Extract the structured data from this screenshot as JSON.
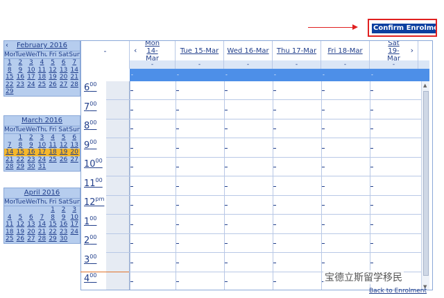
{
  "confirm_button": "Confirm Enrolme",
  "back_link": "Back to Enrolment",
  "watermark": "宝德立斯留学移民",
  "scheduler": {
    "corner": "-",
    "prev_nav": "‹",
    "next_nav": "›",
    "days": [
      "Mon 14-Mar",
      "Tue 15-Mar",
      "Wed 16-Mar",
      "Thu 17-Mar",
      "Fri 18-Mar",
      "Sat 19-Mar"
    ],
    "dash": "-",
    "hours": [
      {
        "h": "6",
        "s": "00"
      },
      {
        "h": "7",
        "s": "00"
      },
      {
        "h": "8",
        "s": "00"
      },
      {
        "h": "9",
        "s": "00"
      },
      {
        "h": "10",
        "s": "00"
      },
      {
        "h": "11",
        "s": "00"
      },
      {
        "h": "12",
        "s": "pm"
      },
      {
        "h": "1",
        "s": "00"
      },
      {
        "h": "2",
        "s": "00"
      },
      {
        "h": "3",
        "s": "00"
      },
      {
        "h": "4",
        "s": "00"
      }
    ]
  },
  "mini_calendars": [
    {
      "prev": "‹",
      "title": "February 2016",
      "weekdays": [
        "Mon",
        "Tue",
        "Wed",
        "Thu",
        "Fri",
        "Sat",
        "Sun"
      ],
      "weeks": [
        [
          "1",
          "2",
          "3",
          "4",
          "5",
          "6",
          "7"
        ],
        [
          "8",
          "9",
          "10",
          "11",
          "12",
          "13",
          "14"
        ],
        [
          "15",
          "16",
          "17",
          "18",
          "19",
          "20",
          "21"
        ],
        [
          "22",
          "23",
          "24",
          "25",
          "26",
          "27",
          "28"
        ],
        [
          "29",
          "",
          "",
          "",
          "",
          "",
          ""
        ]
      ]
    },
    {
      "prev": "",
      "title": "March 2016",
      "weekdays": [
        "Mon",
        "Tue",
        "Wed",
        "Thu",
        "Fri",
        "Sat",
        "Sun"
      ],
      "weeks": [
        [
          "",
          "1",
          "2",
          "3",
          "4",
          "5",
          "6"
        ],
        [
          "7",
          "8",
          "9",
          "10",
          "11",
          "12",
          "13"
        ],
        [
          "14",
          "15",
          "16",
          "17",
          "18",
          "19",
          "20"
        ],
        [
          "21",
          "22",
          "23",
          "24",
          "25",
          "26",
          "27"
        ],
        [
          "28",
          "29",
          "30",
          "31",
          "",
          "",
          ""
        ]
      ],
      "selected_week": 2
    },
    {
      "prev": "",
      "title": "April 2016",
      "weekdays": [
        "Mon",
        "Tue",
        "Wed",
        "Thu",
        "Fri",
        "Sat",
        "Sun"
      ],
      "weeks": [
        [
          "",
          "",
          "",
          "",
          "1",
          "2",
          "3"
        ],
        [
          "4",
          "5",
          "6",
          "7",
          "8",
          "9",
          "10"
        ],
        [
          "11",
          "12",
          "13",
          "14",
          "15",
          "16",
          "17"
        ],
        [
          "18",
          "19",
          "20",
          "21",
          "22",
          "23",
          "24"
        ],
        [
          "25",
          "26",
          "27",
          "28",
          "29",
          "30",
          ""
        ]
      ]
    }
  ],
  "colors": {
    "accent": "#0b3fa0",
    "highlight": "#f5b72a",
    "header_blue": "#4d8fe8",
    "annotation_red": "#e02020"
  }
}
